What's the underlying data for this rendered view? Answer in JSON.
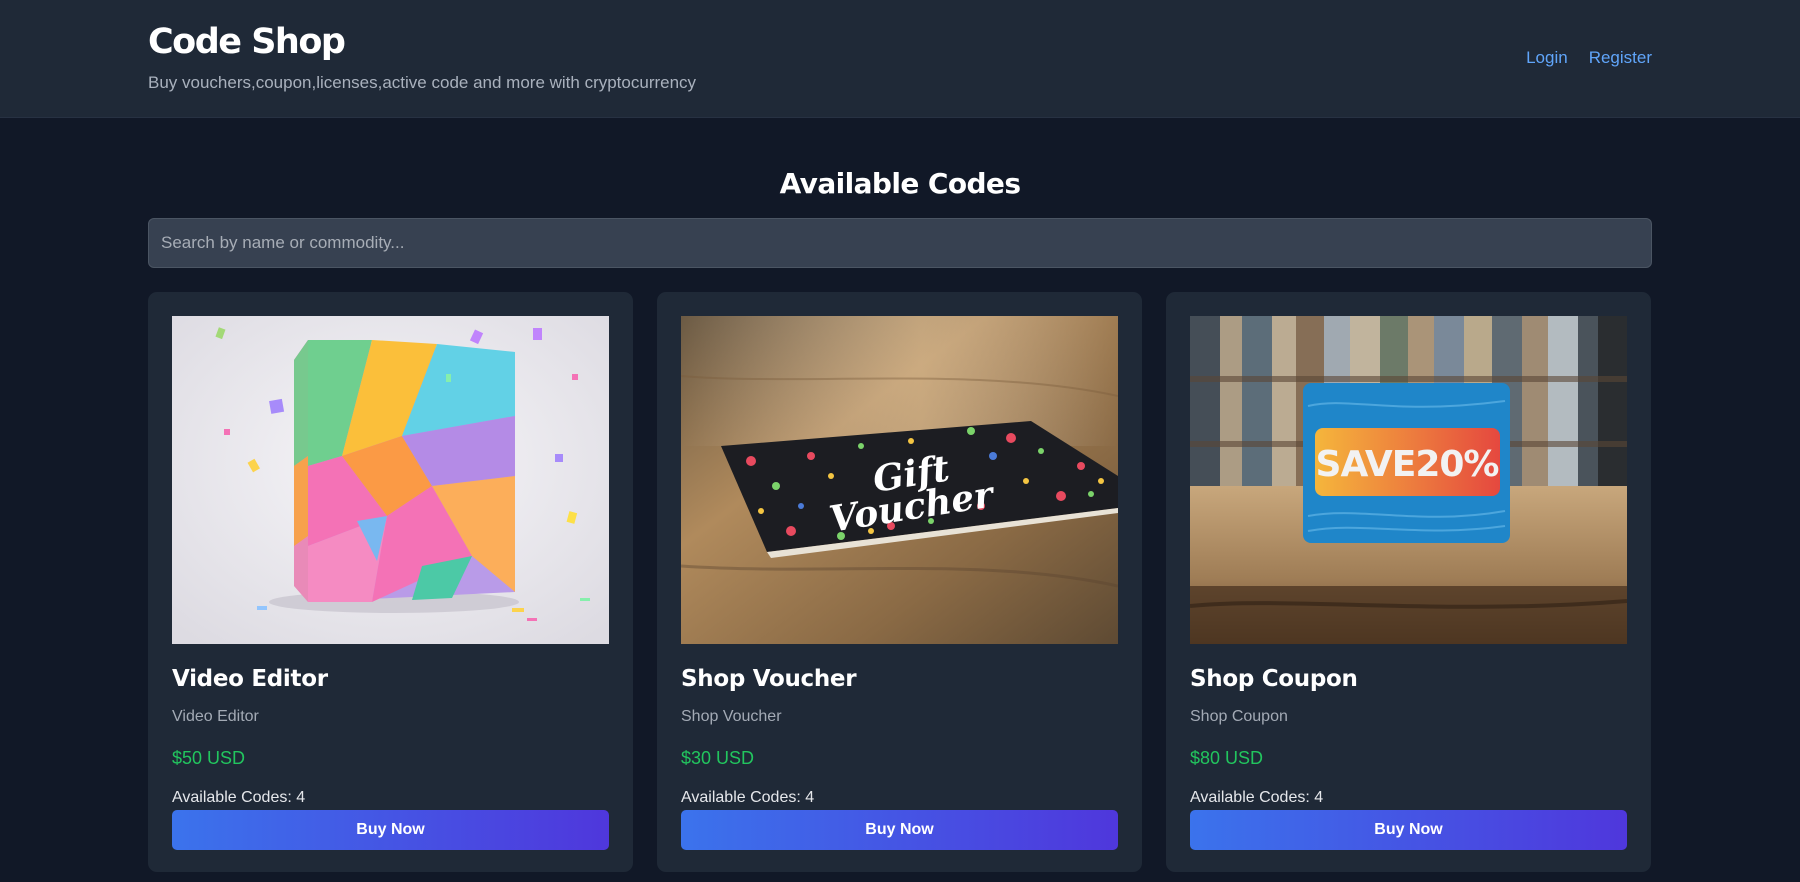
{
  "header": {
    "title": "Code Shop",
    "tagline": "Buy vouchers,coupon,licenses,active code and more with cryptocurrency",
    "nav": {
      "login": "Login",
      "register": "Register"
    }
  },
  "main": {
    "heading": "Available Codes",
    "search": {
      "placeholder": "Search by name or commodity...",
      "value": ""
    }
  },
  "products": [
    {
      "title": "Video Editor",
      "subtitle": "Video Editor",
      "price": "$50 USD",
      "stock": "Available Codes: 4",
      "button": "Buy Now",
      "image": "colorful-gift-box-with-confetti"
    },
    {
      "title": "Shop Voucher",
      "subtitle": "Shop Voucher",
      "price": "$30 USD",
      "stock": "Available Codes: 4",
      "button": "Buy Now",
      "image": "gift-voucher-card-on-wooden-table",
      "image_text": "Gift Voucher"
    },
    {
      "title": "Shop Coupon",
      "subtitle": "Shop Coupon",
      "price": "$80 USD",
      "stock": "Available Codes: 4",
      "button": "Buy Now",
      "image": "blue-coupon-card-on-wooden-table",
      "image_text": "SAVE20%"
    }
  ],
  "colors": {
    "background": "#111827",
    "surface": "#1f2937",
    "link": "#60a5fa",
    "price": "#22c55e",
    "button_start": "#3b73ec",
    "button_end": "#4f37dc"
  }
}
